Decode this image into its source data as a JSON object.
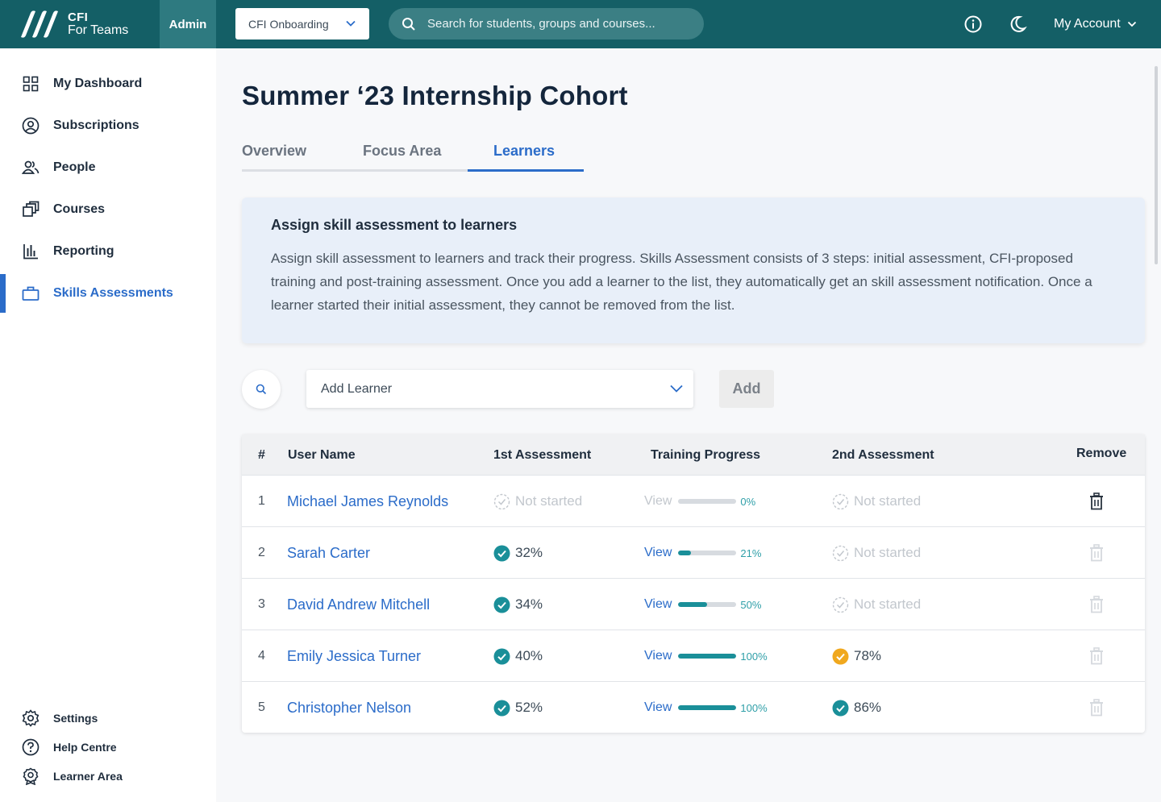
{
  "brand": {
    "line1": "CFI",
    "line2": "For Teams",
    "admin_label": "Admin"
  },
  "header": {
    "org_select": "CFI Onboarding",
    "search_placeholder": "Search for students, groups and courses...",
    "account_label": "My Account"
  },
  "sidebar": {
    "items": [
      {
        "label": "My Dashboard",
        "icon": "dashboard-icon"
      },
      {
        "label": "Subscriptions",
        "icon": "user-circle-icon"
      },
      {
        "label": "People",
        "icon": "people-icon"
      },
      {
        "label": "Courses",
        "icon": "courses-icon"
      },
      {
        "label": "Reporting",
        "icon": "bar-chart-icon"
      },
      {
        "label": "Skills Assessments",
        "icon": "briefcase-icon",
        "active": true
      }
    ],
    "footer": [
      {
        "label": "Settings",
        "icon": "gear-icon"
      },
      {
        "label": "Help Centre",
        "icon": "help-icon"
      },
      {
        "label": "Learner Area",
        "icon": "badge-icon"
      }
    ]
  },
  "page": {
    "title": "Summer ‘23 Internship Cohort",
    "tabs": [
      {
        "label": "Overview"
      },
      {
        "label": "Focus Area"
      },
      {
        "label": "Learners",
        "active": true
      }
    ]
  },
  "info": {
    "heading": "Assign skill assessment to learners",
    "body": "Assign skill assessment to learners and track their progress. Skills Assessment consists of 3 steps: initial assessment, CFI-proposed training and post-training assessment. Once you add a learner to the list, they automatically get an skill assessment notification. Once a learner started their initial assessment, they cannot be removed from the list."
  },
  "add_learner": {
    "placeholder": "Add Learner",
    "button": "Add"
  },
  "table": {
    "headers": {
      "num": "#",
      "user": "User Name",
      "first": "1st Assessment",
      "training": "Training Progress",
      "second": "2nd Assessment",
      "remove": "Remove"
    },
    "view_label": "View",
    "rows": [
      {
        "num": "1",
        "name": "Michael James Reynolds",
        "first": "Not started",
        "first_done": false,
        "progress": 0,
        "progress_label": "0%",
        "second": "Not started",
        "second_state": "none",
        "removable": true
      },
      {
        "num": "2",
        "name": "Sarah Carter",
        "first": "32%",
        "first_done": true,
        "progress": 21,
        "progress_label": "21%",
        "second": "Not started",
        "second_state": "none",
        "removable": false
      },
      {
        "num": "3",
        "name": "David Andrew Mitchell",
        "first": "34%",
        "first_done": true,
        "progress": 50,
        "progress_label": "50%",
        "second": "Not started",
        "second_state": "none",
        "removable": false
      },
      {
        "num": "4",
        "name": "Emily Jessica Turner",
        "first": "40%",
        "first_done": true,
        "progress": 100,
        "progress_label": "100%",
        "second": "78%",
        "second_state": "warning",
        "removable": false
      },
      {
        "num": "5",
        "name": "Christopher Nelson",
        "first": "52%",
        "first_done": true,
        "progress": 100,
        "progress_label": "100%",
        "second": "86%",
        "second_state": "done",
        "removable": false
      }
    ]
  },
  "colors": {
    "topbar": "#145f66",
    "accent": "#2b6cc9",
    "check": "#1a8f99",
    "warning": "#f0a81e"
  }
}
